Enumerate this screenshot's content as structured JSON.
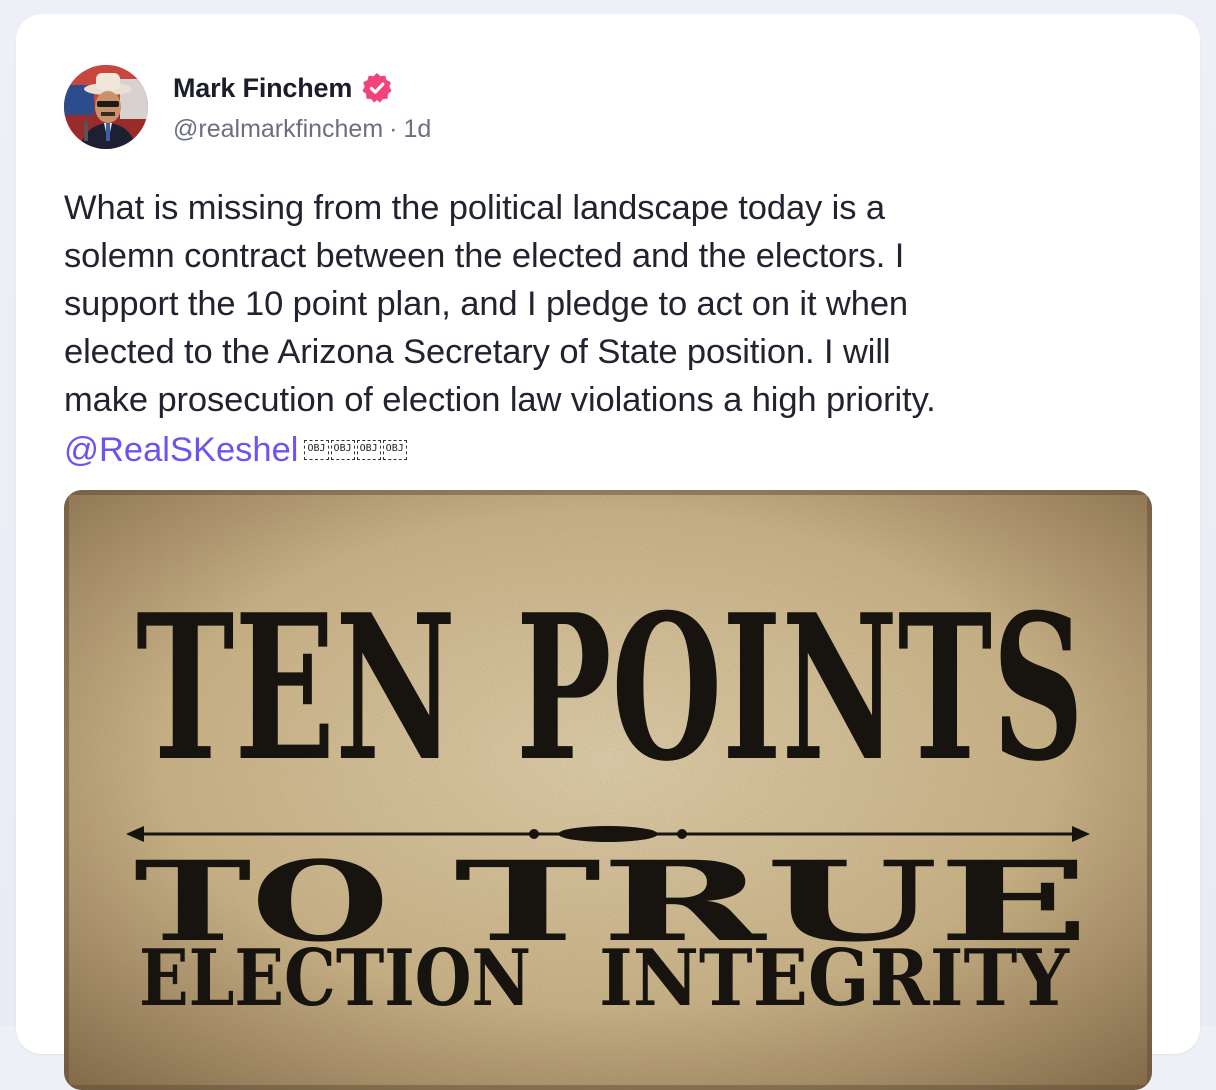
{
  "post": {
    "author_name": "Mark Finchem",
    "verified_icon": "verified-badge-icon",
    "handle": "@realmarkfinchem",
    "separator": "·",
    "time": "1d",
    "body_lines": [
      "What is missing from the political landscape today is a",
      "solemn contract between the elected and the electors. I",
      "support the 10 point plan, and I pledge to act on it when",
      "elected to the Arizona Secretary of State position. I will",
      "make prosecution of election law violations a high priority."
    ],
    "mention": "@RealSKeshel",
    "obj_placeholders": [
      "OBJ",
      "OBJ",
      "OBJ",
      "OBJ"
    ]
  },
  "media": {
    "poster_line1_left": "TEN",
    "poster_line1_right": "POINTS",
    "poster_line2_left": "TO",
    "poster_line2_right": "TRUE",
    "poster_line3_left": "ELECTION",
    "poster_line3_right": "INTEGRITY"
  },
  "colors": {
    "accent": "#6b55f0",
    "verified": "#f0457a",
    "text": "#22232f",
    "muted": "#6c6f82"
  }
}
